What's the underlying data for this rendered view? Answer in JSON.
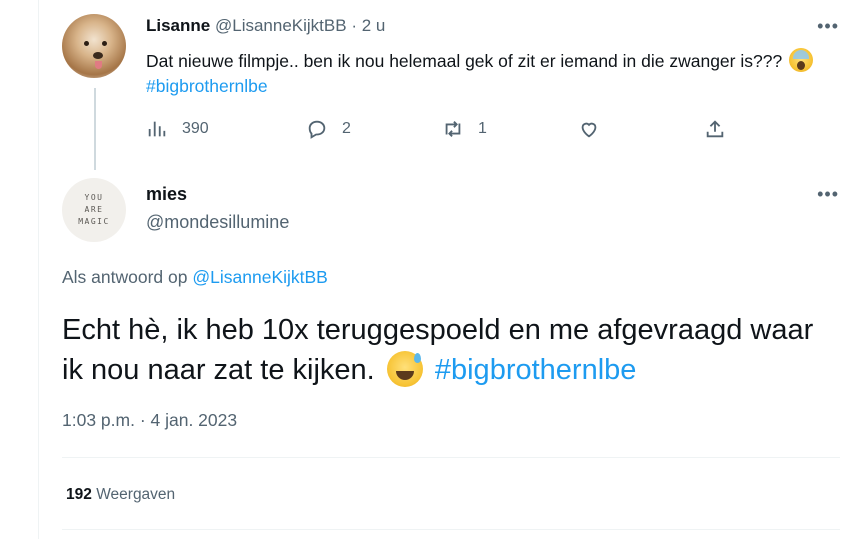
{
  "parent_tweet": {
    "name": "Lisanne",
    "handle": "@LisanneKijktBB",
    "time": "2 u",
    "text": "Dat nieuwe filmpje.. ben ik nou helemaal gek of zit er iemand in die zwanger is???",
    "emoji": "scream-emoji",
    "hashtag": "#bigbrothernlbe",
    "stats": {
      "views": "390",
      "replies": "2",
      "retweets": "1",
      "likes": ""
    }
  },
  "reply_tweet": {
    "name": "mies",
    "handle": "@mondesillumine",
    "avatar_text": [
      "YOU",
      "ARE",
      "MAGIC"
    ],
    "reply_prefix": "Als antwoord op",
    "reply_to": "@LisanneKijktBB",
    "text": "Echt hè, ik heb 10x teruggespoeld en me afgevraagd waar ik nou naar zat te kijken.",
    "emoji": "sweat-smile-emoji",
    "hashtag": "#bigbrothernlbe",
    "timestamp": "1:03 p.m. · 4 jan. 2023",
    "views_count": "192",
    "views_label": "Weergaven"
  },
  "colors": {
    "accent": "#1d9bf0",
    "text": "#0f1419",
    "secondary": "#536471",
    "border": "#eff3f4"
  }
}
